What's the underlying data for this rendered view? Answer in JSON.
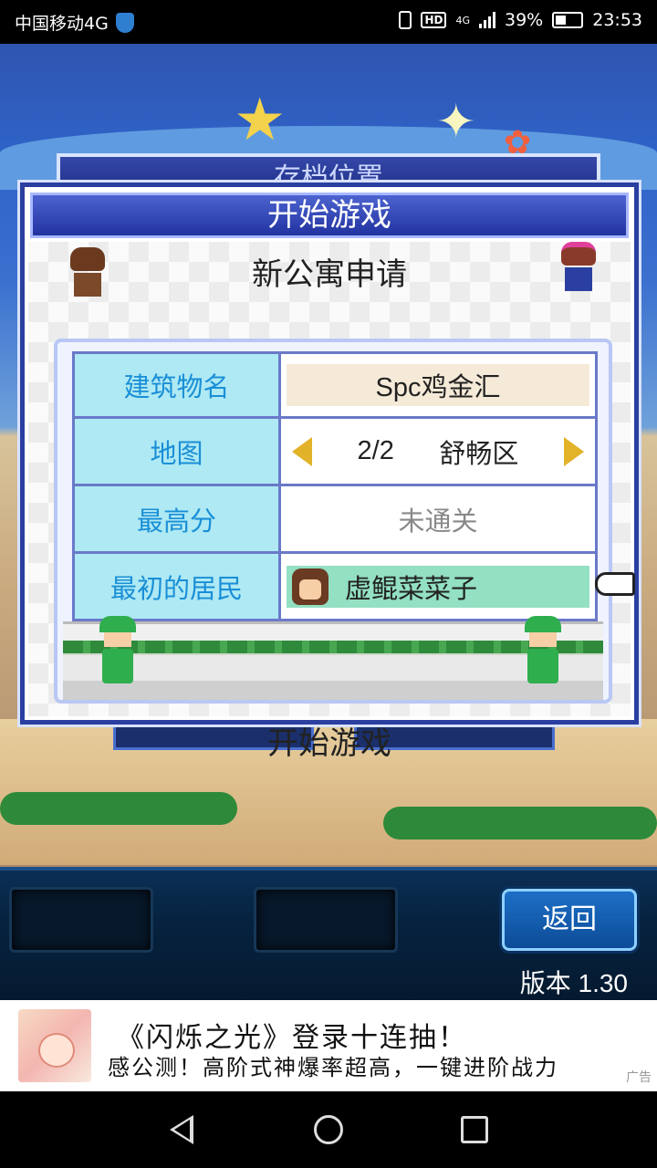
{
  "status_bar": {
    "carrier": "中国移动4G",
    "hd": "HD",
    "network": "4G",
    "battery": "39%",
    "time": "23:53"
  },
  "background": {
    "plaque_text": "存档位置"
  },
  "dialog": {
    "title": "开始游戏",
    "subtitle": "新公寓申请",
    "rows": {
      "building": {
        "label": "建筑物名",
        "value": "Spc鸡金汇"
      },
      "map": {
        "label": "地图",
        "page": "2/2",
        "district": "舒畅区"
      },
      "highscore": {
        "label": "最高分",
        "value": "未通关"
      },
      "resident": {
        "label": "最初的居民",
        "value": "虚鲲菜菜子"
      }
    },
    "start_label": "开始游戏"
  },
  "panel": {
    "back_label": "返回",
    "version": "版本 1.30"
  },
  "ad": {
    "title": "《闪烁之光》登录十连抽！",
    "text": "感公测！高阶式神爆率超高，一键进阶战力",
    "tag": "广告"
  },
  "colors": {
    "dialog_border": "#2a3fa0",
    "label_bg": "#aee9f4",
    "label_text": "#1a8fd6",
    "resident_bg": "#93e0c3",
    "name_bg": "#f5ead8",
    "back_button": "#1d6fc6"
  }
}
